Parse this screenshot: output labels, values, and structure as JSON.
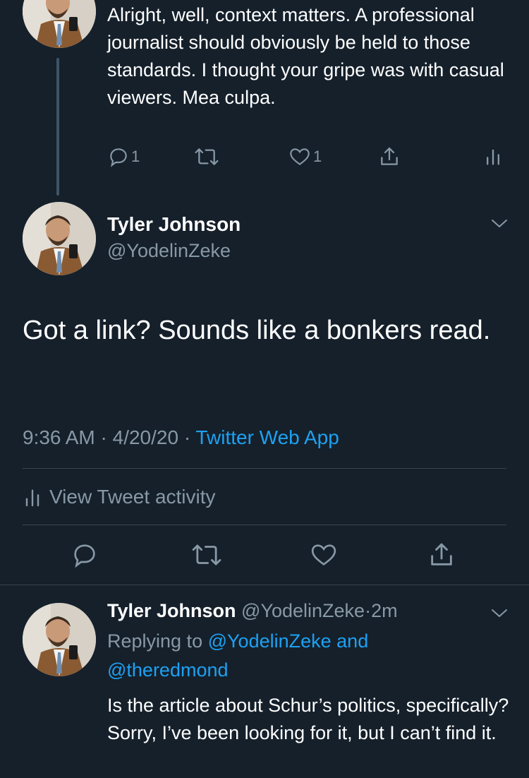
{
  "thread_tweet": {
    "text": "Alright, well, context matters. A professional journalist should obviously be held to those standards. I thought your gripe was with casual viewers. Mea culpa.",
    "reply_count": "1",
    "like_count": "1"
  },
  "main_tweet": {
    "name": "Tyler Johnson",
    "handle": "@YodelinZeke",
    "text": "Got a link? Sounds like a bonkers read.",
    "time": "9:36 AM",
    "date": "4/20/20",
    "source": "Twitter Web App",
    "separator": "·",
    "activity_label": "View Tweet activity"
  },
  "reply_tweet": {
    "name": "Tyler Johnson",
    "handle": "@YodelinZeke",
    "age": "2m",
    "replying_prefix": "Replying to",
    "replying_user1": "@YodelinZeke",
    "replying_and": "and",
    "replying_user2": "@theredmond",
    "text": "Is the article about Schur’s politics, specifically? Sorry, I’ve been looking for it, but I can’t find it."
  },
  "icons": [
    "reply-icon",
    "retweet-icon",
    "like-icon",
    "share-icon",
    "analytics-icon",
    "chevron-down-icon"
  ],
  "colors": {
    "background": "#15202b",
    "text": "#ffffff",
    "muted": "#8899a6",
    "link": "#1da1f2",
    "divider": "#38444d"
  }
}
